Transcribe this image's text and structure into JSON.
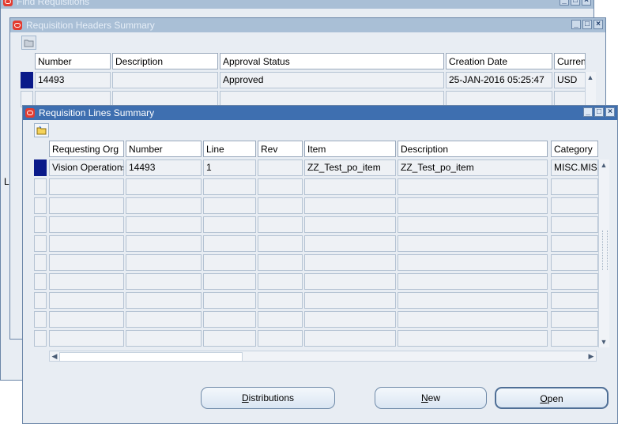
{
  "find_window": {
    "title": "Find Requisitions"
  },
  "headers_window": {
    "title": "Requisition Headers Summary",
    "columns": [
      "Number",
      "Description",
      "Approval Status",
      "Creation Date",
      "Curren"
    ],
    "rows": [
      {
        "number": "14493",
        "description": "",
        "approval_status": "Approved",
        "creation_date": "25-JAN-2016 05:25:47",
        "currency": "USD"
      }
    ]
  },
  "left_fragment_text": "L",
  "lines_window": {
    "title": "Requisition Lines Summary",
    "columns": [
      "Requesting Org",
      "Number",
      "Line",
      "Rev",
      "Item",
      "Description",
      "Category"
    ],
    "rows": [
      {
        "requesting_org": "Vision Operations",
        "number": "14493",
        "line": "1",
        "rev": "",
        "item": "ZZ_Test_po_item",
        "description": "ZZ_Test_po_item",
        "category": "MISC.MISC"
      }
    ],
    "buttons": {
      "distributions": {
        "pre": "",
        "u": "D",
        "post": "istributions"
      },
      "new": {
        "pre": "",
        "u": "N",
        "post": "ew"
      },
      "open": {
        "pre": "",
        "u": "O",
        "post": "pen"
      }
    }
  },
  "icons": {
    "folder": "open-folder-icon",
    "window_controls": [
      "minimize-icon",
      "maximize-icon",
      "close-icon"
    ]
  },
  "colors": {
    "selected_row_marker": "#0a1a8a",
    "active_title": "#3e6fb0",
    "inactive_title": "#a9bfd6"
  }
}
